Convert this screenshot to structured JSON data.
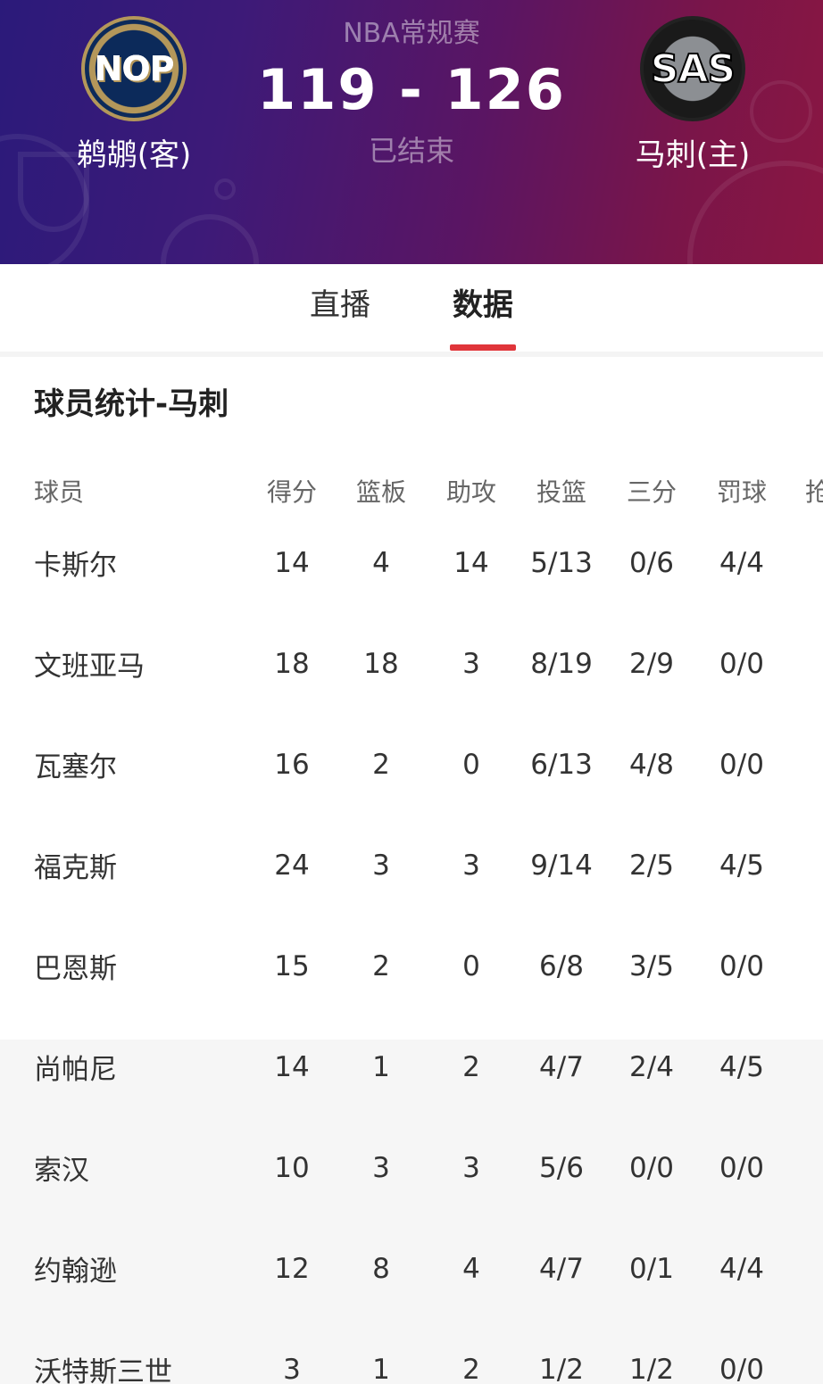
{
  "game": {
    "league": "NBA常规赛",
    "score": "119 - 126",
    "status": "已结束",
    "away": {
      "abbr": "NOP",
      "name": "鹈鹕(客)"
    },
    "home": {
      "abbr": "SAS",
      "name": "马刺(主)"
    }
  },
  "tabs": [
    {
      "label": "直播",
      "active": false
    },
    {
      "label": "数据",
      "active": true
    }
  ],
  "stats": {
    "title": "球员统计-马刺",
    "columns": [
      "球员",
      "得分",
      "篮板",
      "助攻",
      "投篮",
      "三分",
      "罚球",
      "抢"
    ],
    "rows": [
      [
        "卡斯尔",
        "14",
        "4",
        "14",
        "5/13",
        "0/6",
        "4/4"
      ],
      [
        "文班亚马",
        "18",
        "18",
        "3",
        "8/19",
        "2/9",
        "0/0"
      ],
      [
        "瓦塞尔",
        "16",
        "2",
        "0",
        "6/13",
        "4/8",
        "0/0"
      ],
      [
        "福克斯",
        "24",
        "3",
        "3",
        "9/14",
        "2/5",
        "4/5"
      ],
      [
        "巴恩斯",
        "15",
        "2",
        "0",
        "6/8",
        "3/5",
        "0/0"
      ],
      [
        "尚帕尼",
        "14",
        "1",
        "2",
        "4/7",
        "2/4",
        "4/5"
      ],
      [
        "索汉",
        "10",
        "3",
        "3",
        "5/6",
        "0/0",
        "0/0"
      ],
      [
        "约翰逊",
        "12",
        "8",
        "4",
        "4/7",
        "0/1",
        "4/4"
      ],
      [
        "沃特斯三世",
        "3",
        "1",
        "2",
        "1/2",
        "1/2",
        "0/0"
      ]
    ]
  },
  "colors": {
    "accent": "#e0353a",
    "header_gradient_start": "#2b1a7a",
    "header_gradient_end": "#8a1642"
  }
}
